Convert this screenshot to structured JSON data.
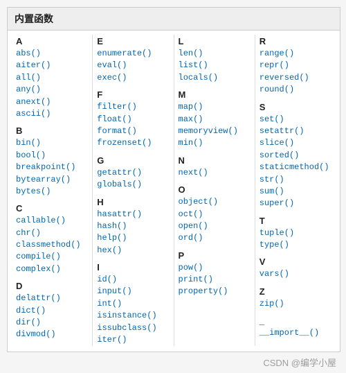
{
  "header_title": "内置函数",
  "columns": [
    [
      {
        "head": "A",
        "items": [
          "abs()",
          "aiter()",
          "all()",
          "any()",
          "anext()",
          "ascii()"
        ]
      },
      {
        "head": "B",
        "items": [
          "bin()",
          "bool()",
          "breakpoint()",
          "bytearray()",
          "bytes()"
        ]
      },
      {
        "head": "C",
        "items": [
          "callable()",
          "chr()",
          "classmethod()",
          "compile()",
          "complex()"
        ]
      },
      {
        "head": "D",
        "items": [
          "delattr()",
          "dict()",
          "dir()",
          "divmod()"
        ]
      }
    ],
    [
      {
        "head": "E",
        "items": [
          "enumerate()",
          "eval()",
          "exec()"
        ]
      },
      {
        "head": "F",
        "items": [
          "filter()",
          "float()",
          "format()",
          "frozenset()"
        ]
      },
      {
        "head": "G",
        "items": [
          "getattr()",
          "globals()"
        ]
      },
      {
        "head": "H",
        "items": [
          "hasattr()",
          "hash()",
          "help()",
          "hex()"
        ]
      },
      {
        "head": "I",
        "items": [
          "id()",
          "input()",
          "int()",
          "isinstance()",
          "issubclass()",
          "iter()"
        ]
      }
    ],
    [
      {
        "head": "L",
        "items": [
          "len()",
          "list()",
          "locals()"
        ]
      },
      {
        "head": "M",
        "items": [
          "map()",
          "max()",
          "memoryview()",
          "min()"
        ]
      },
      {
        "head": "N",
        "items": [
          "next()"
        ]
      },
      {
        "head": "O",
        "items": [
          "object()",
          "oct()",
          "open()",
          "ord()"
        ]
      },
      {
        "head": "P",
        "items": [
          "pow()",
          "print()",
          "property()"
        ]
      }
    ],
    [
      {
        "head": "R",
        "items": [
          "range()",
          "repr()",
          "reversed()",
          "round()"
        ]
      },
      {
        "head": "S",
        "items": [
          "set()",
          "setattr()",
          "slice()",
          "sorted()",
          "staticmethod()",
          "str()",
          "sum()",
          "super()"
        ]
      },
      {
        "head": "T",
        "items": [
          "tuple()",
          "type()"
        ]
      },
      {
        "head": "V",
        "items": [
          "vars()"
        ]
      },
      {
        "head": "Z",
        "items": [
          "zip()"
        ]
      },
      {
        "head": "_",
        "items": [
          "__import__()"
        ]
      }
    ]
  ],
  "watermark": "CSDN @编学小屋"
}
